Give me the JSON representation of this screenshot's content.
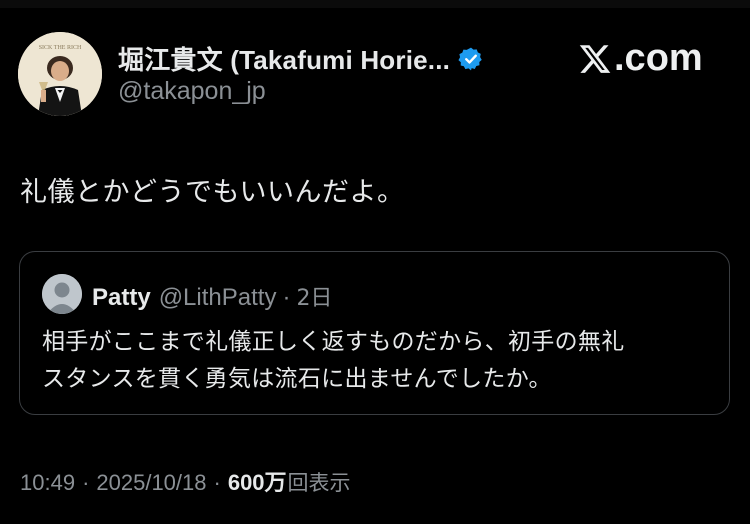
{
  "author": {
    "display_name": "堀江貴文 (Takafumi Horie...",
    "handle": "@takapon_jp",
    "verified_icon": "verified-badge-icon",
    "avatar_icon": "avatar-photo",
    "avatar_caption": "SICK THE RICH"
  },
  "brand": {
    "label": ".com",
    "logo_icon": "x-logo-icon"
  },
  "tweet": {
    "text": "礼儀とかどうでもいいんだよ。"
  },
  "quote": {
    "name": "Patty",
    "handle": "@LithPatty",
    "separator": "·",
    "time": "2日",
    "text_lines": [
      "相手がここまで礼儀正しく返すものだから、初手の無礼",
      "スタンスを貫く勇気は流石に出ませんでしたか。"
    ]
  },
  "meta": {
    "time": "10:49",
    "sep1": "·",
    "date": "2025/10/18",
    "sep2": "·",
    "views_count": "600万",
    "views_label": "回表示"
  },
  "colors": {
    "background": "#000000",
    "text_primary": "#e7e9ea",
    "text_secondary": "#8b9095",
    "verified_blue": "#1d9bf0",
    "card_border": "#3a3d41"
  }
}
